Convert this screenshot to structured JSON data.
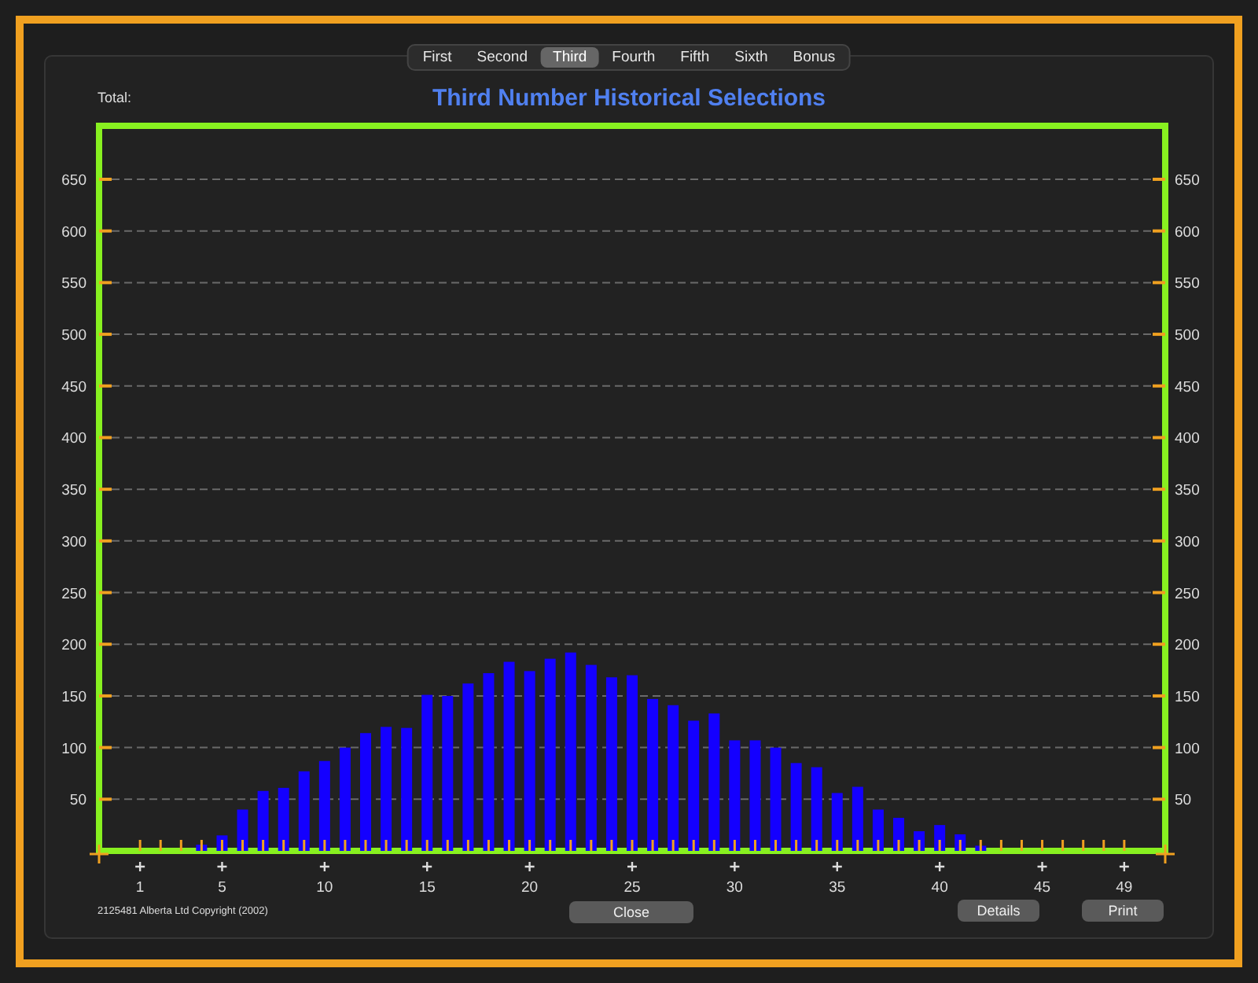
{
  "tabs": [
    {
      "label": "First",
      "selected": false
    },
    {
      "label": "Second",
      "selected": false
    },
    {
      "label": "Third",
      "selected": true
    },
    {
      "label": "Fourth",
      "selected": false
    },
    {
      "label": "Fifth",
      "selected": false
    },
    {
      "label": "Sixth",
      "selected": false
    },
    {
      "label": "Bonus",
      "selected": false
    }
  ],
  "total_label": "Total:",
  "chart": {
    "chart_data": {
      "type": "bar",
      "title": "Third Number Historical Selections",
      "x": [
        1,
        2,
        3,
        4,
        5,
        6,
        7,
        8,
        9,
        10,
        11,
        12,
        13,
        14,
        15,
        16,
        17,
        18,
        19,
        20,
        21,
        22,
        23,
        24,
        25,
        26,
        27,
        28,
        29,
        30,
        31,
        32,
        33,
        34,
        35,
        36,
        37,
        38,
        39,
        40,
        41,
        42,
        43,
        44,
        45,
        46,
        47,
        48,
        49
      ],
      "series": [
        {
          "color": "#1400ff",
          "values": [
            0,
            0,
            0,
            6,
            15,
            40,
            58,
            61,
            77,
            87,
            100,
            114,
            120,
            119,
            151,
            150,
            162,
            172,
            183,
            174,
            186,
            192,
            180,
            168,
            170,
            147,
            141,
            126,
            133,
            107,
            107,
            100,
            85,
            81,
            56,
            62,
            40,
            32,
            19,
            25,
            16,
            5,
            0,
            0,
            0,
            0,
            0,
            0,
            0
          ]
        }
      ],
      "grid": true,
      "ylim": [
        0,
        650
      ],
      "xlim": [
        -1,
        51
      ],
      "yticks": [
        50,
        100,
        150,
        200,
        250,
        300,
        350,
        400,
        450,
        500,
        550,
        600,
        650
      ],
      "xticks": [
        1,
        5,
        10,
        15,
        20,
        25,
        30,
        35,
        40,
        45,
        49
      ]
    },
    "left_axis_labels": [
      "650",
      "600",
      "550",
      "500",
      "450",
      "400",
      "350",
      "300",
      "250",
      "200",
      "150",
      "100",
      "50"
    ]
  },
  "copyright": "2125481 Alberta Ltd Copyright (2002)",
  "buttons": [
    {
      "label": "Close",
      "kind": "center"
    },
    {
      "label": "Details",
      "kind": "right"
    },
    {
      "label": "Print",
      "kind": "right"
    }
  ]
}
